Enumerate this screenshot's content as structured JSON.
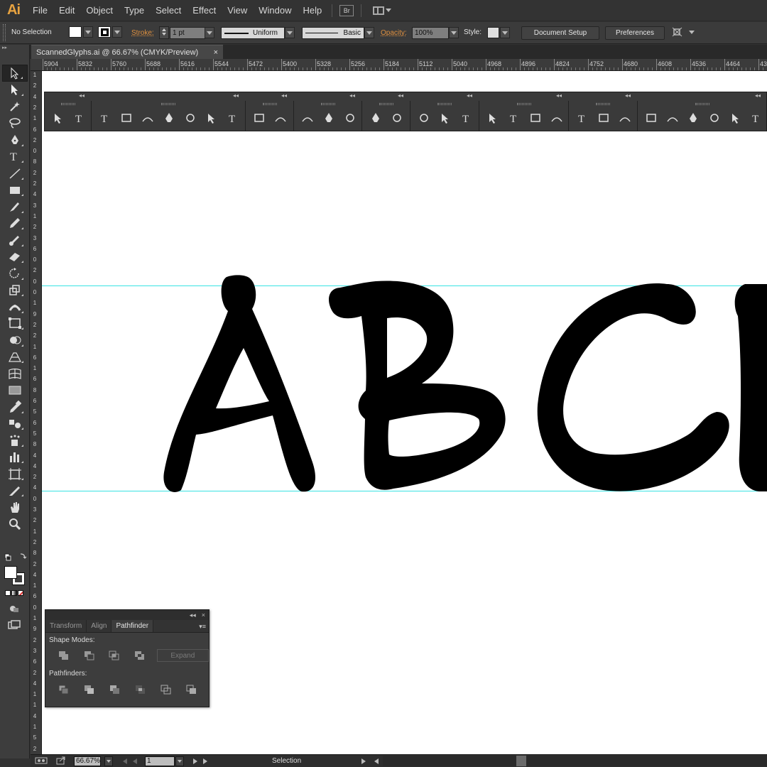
{
  "app": {
    "logo": "Ai",
    "accent": "#e8a340"
  },
  "menu": {
    "items": [
      "File",
      "Edit",
      "Object",
      "Type",
      "Select",
      "Effect",
      "View",
      "Window",
      "Help"
    ],
    "bridge_label": "Br"
  },
  "control_bar": {
    "selection_state": "No Selection",
    "stroke_label": "Stroke:",
    "stroke_weight": "1 pt",
    "profile_value": "Uniform",
    "brush_value": "Basic",
    "opacity_label": "Opacity:",
    "opacity_value": "100%",
    "style_label": "Style:",
    "document_setup_label": "Document Setup",
    "preferences_label": "Preferences"
  },
  "document": {
    "tab_title": "ScannedGlyphs.ai @ 66.67% (CMYK/Preview)",
    "close_glyph": "×"
  },
  "ruler": {
    "top_labels": [
      "5904",
      "5832",
      "5760",
      "5688",
      "5616",
      "5544",
      "5472",
      "5400",
      "5328",
      "5256",
      "5184",
      "5112",
      "5040",
      "4968",
      "4896",
      "4824",
      "4752",
      "4680",
      "4608",
      "4536",
      "4464",
      "43"
    ],
    "left_labels": [
      "1",
      "2",
      "4",
      "2",
      "1",
      "6",
      "2",
      "0",
      "8",
      "2",
      "2",
      "4",
      "3",
      "1",
      "2",
      "3",
      "6",
      "0",
      "2",
      "0",
      "0",
      "1",
      "9",
      "2",
      "2",
      "1",
      "6",
      "1",
      "6",
      "8",
      "6",
      "5",
      "6",
      "5",
      "8",
      "4",
      "4",
      "2",
      "4",
      "0",
      "3",
      "2",
      "1",
      "2",
      "8",
      "2",
      "4",
      "1",
      "6",
      "0",
      "1",
      "9",
      "2",
      "3",
      "6",
      "2",
      "4",
      "1",
      "1",
      "4",
      "1",
      "5",
      "2"
    ]
  },
  "canvas": {
    "glyphs_text": "ABCD",
    "guide_color": "#39e3e3"
  },
  "tools": [
    "selection-tool",
    "direct-selection-tool",
    "magic-wand-tool",
    "lasso-tool",
    "pen-tool",
    "type-tool",
    "line-segment-tool",
    "rectangle-tool",
    "paintbrush-tool",
    "pencil-tool",
    "blob-brush-tool",
    "eraser-tool",
    "rotate-tool",
    "scale-tool",
    "width-tool",
    "free-transform-tool",
    "shape-builder-tool",
    "perspective-grid-tool",
    "mesh-tool",
    "gradient-tool",
    "eyedropper-tool",
    "blend-tool",
    "symbol-sprayer-tool",
    "column-graph-tool",
    "artboard-tool",
    "slice-tool",
    "hand-tool",
    "zoom-tool"
  ],
  "pathfinder_panel": {
    "tabs": [
      "Transform",
      "Align",
      "Pathfinder"
    ],
    "active_tab": "Pathfinder",
    "shape_modes_label": "Shape Modes:",
    "expand_label": "Expand",
    "pathfinders_label": "Pathfinders:"
  },
  "status_bar": {
    "zoom": "66.67%",
    "artboard_number": "1",
    "current_tool": "Selection"
  }
}
